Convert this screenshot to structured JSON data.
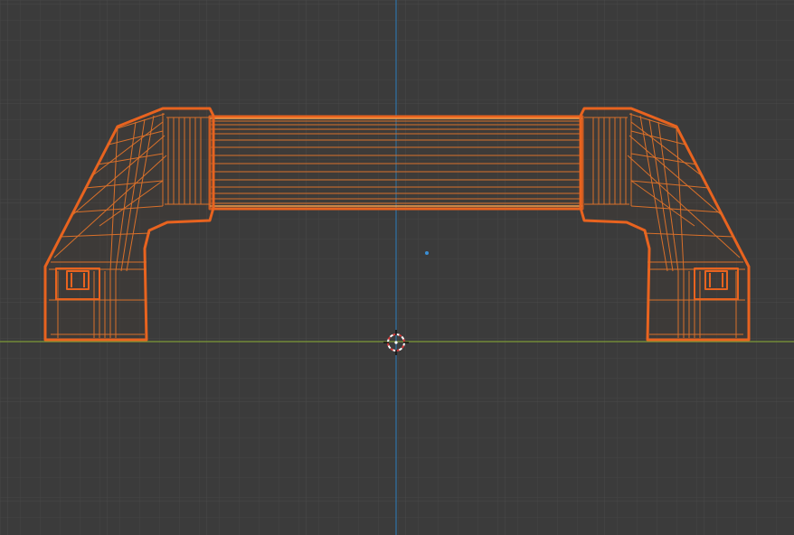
{
  "viewport": {
    "view": "front-orthographic",
    "shading": "wireframe",
    "background_color": "#3b3b3b",
    "grid_minor_color": "#454545",
    "grid_major_color": "#4c4c4c",
    "x_axis_color": "#7c9a36",
    "z_axis_color": "#2f6f9f",
    "selection_outline_color": "#e8631f",
    "selection_inner_color": "#d9702a",
    "selection_highlight_color": "#f5a04c"
  },
  "scene": {
    "selected_object": "handle-mesh",
    "origin_point": "object-origin",
    "cursor": "3d-cursor"
  }
}
